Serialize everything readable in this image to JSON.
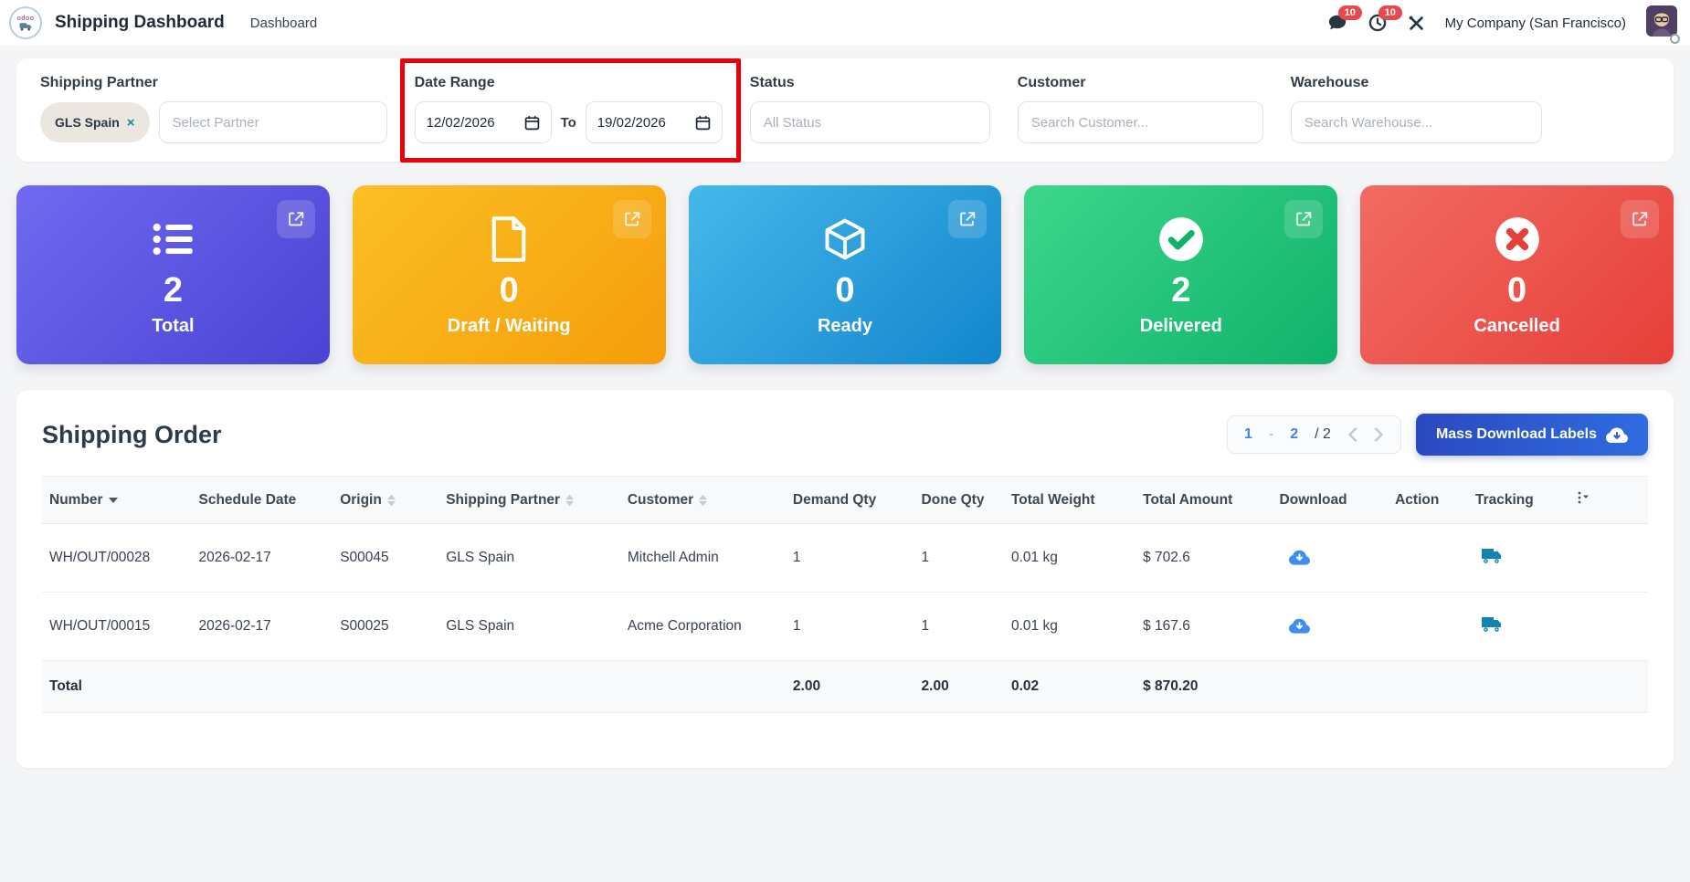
{
  "topbar": {
    "app_title": "Shipping Dashboard",
    "menu_dashboard": "Dashboard",
    "messages_badge": "10",
    "activities_badge": "10",
    "company": "My Company (San Francisco)"
  },
  "filters": {
    "shipping_partner": {
      "label": "Shipping Partner",
      "chip": "GLS Spain",
      "chip_remove": "×",
      "placeholder": "Select Partner"
    },
    "date_range": {
      "label": "Date Range",
      "from": "12/02/2026",
      "to_label": "To",
      "to": "19/02/2026"
    },
    "status": {
      "label": "Status",
      "placeholder": "All Status"
    },
    "customer": {
      "label": "Customer",
      "placeholder": "Search Customer..."
    },
    "warehouse": {
      "label": "Warehouse",
      "placeholder": "Search Warehouse..."
    }
  },
  "cards": [
    {
      "label": "Total",
      "value": "2",
      "icon": "list-icon",
      "from": "#6f6af0",
      "to": "#4a42d4"
    },
    {
      "label": "Draft / Waiting",
      "value": "0",
      "icon": "document-icon",
      "from": "#fbbf24",
      "to": "#f59e0b"
    },
    {
      "label": "Ready",
      "value": "0",
      "icon": "cube-icon",
      "from": "#45b8ea",
      "to": "#1385cd"
    },
    {
      "label": "Delivered",
      "value": "2",
      "icon": "check-circle-icon",
      "from": "#3dd68c",
      "to": "#10b26b"
    },
    {
      "label": "Cancelled",
      "value": "0",
      "icon": "x-circle-icon",
      "from": "#f26b63",
      "to": "#e63f38"
    }
  ],
  "orders": {
    "title": "Shipping Order",
    "pagination": {
      "range_start": "1",
      "separator": "-",
      "range_end": "2",
      "total": "/ 2"
    },
    "mass_download_label": "Mass Download Labels",
    "columns": [
      "Number",
      "Schedule Date",
      "Origin",
      "Shipping Partner",
      "Customer",
      "Demand Qty",
      "Done Qty",
      "Total Weight",
      "Total Amount",
      "Download",
      "Action",
      "Tracking"
    ],
    "rows": [
      {
        "number": "WH/OUT/00028",
        "schedule_date": "2026-02-17",
        "origin": "S00045",
        "shipping_partner": "GLS Spain",
        "customer": "Mitchell Admin",
        "demand_qty": "1",
        "done_qty": "1",
        "total_weight": "0.01 kg",
        "total_amount": "$ 702.6"
      },
      {
        "number": "WH/OUT/00015",
        "schedule_date": "2026-02-17",
        "origin": "S00025",
        "shipping_partner": "GLS Spain",
        "customer": "Acme Corporation",
        "demand_qty": "1",
        "done_qty": "1",
        "total_weight": "0.01 kg",
        "total_amount": "$ 167.6"
      }
    ],
    "total_row": {
      "label": "Total",
      "demand_qty": "2.00",
      "done_qty": "2.00",
      "total_weight": "0.02",
      "total_amount": "$ 870.20"
    }
  },
  "colors": {
    "annotation_red": "#e8000a",
    "badge_red": "#e5484d",
    "link_teal": "#0f8fa0",
    "primary_button_blue": "#2f6ce0",
    "download_icon_blue": "#3d8ef0",
    "truck_icon_teal": "#1185ad",
    "pagination_blue": "#3b82f6"
  }
}
